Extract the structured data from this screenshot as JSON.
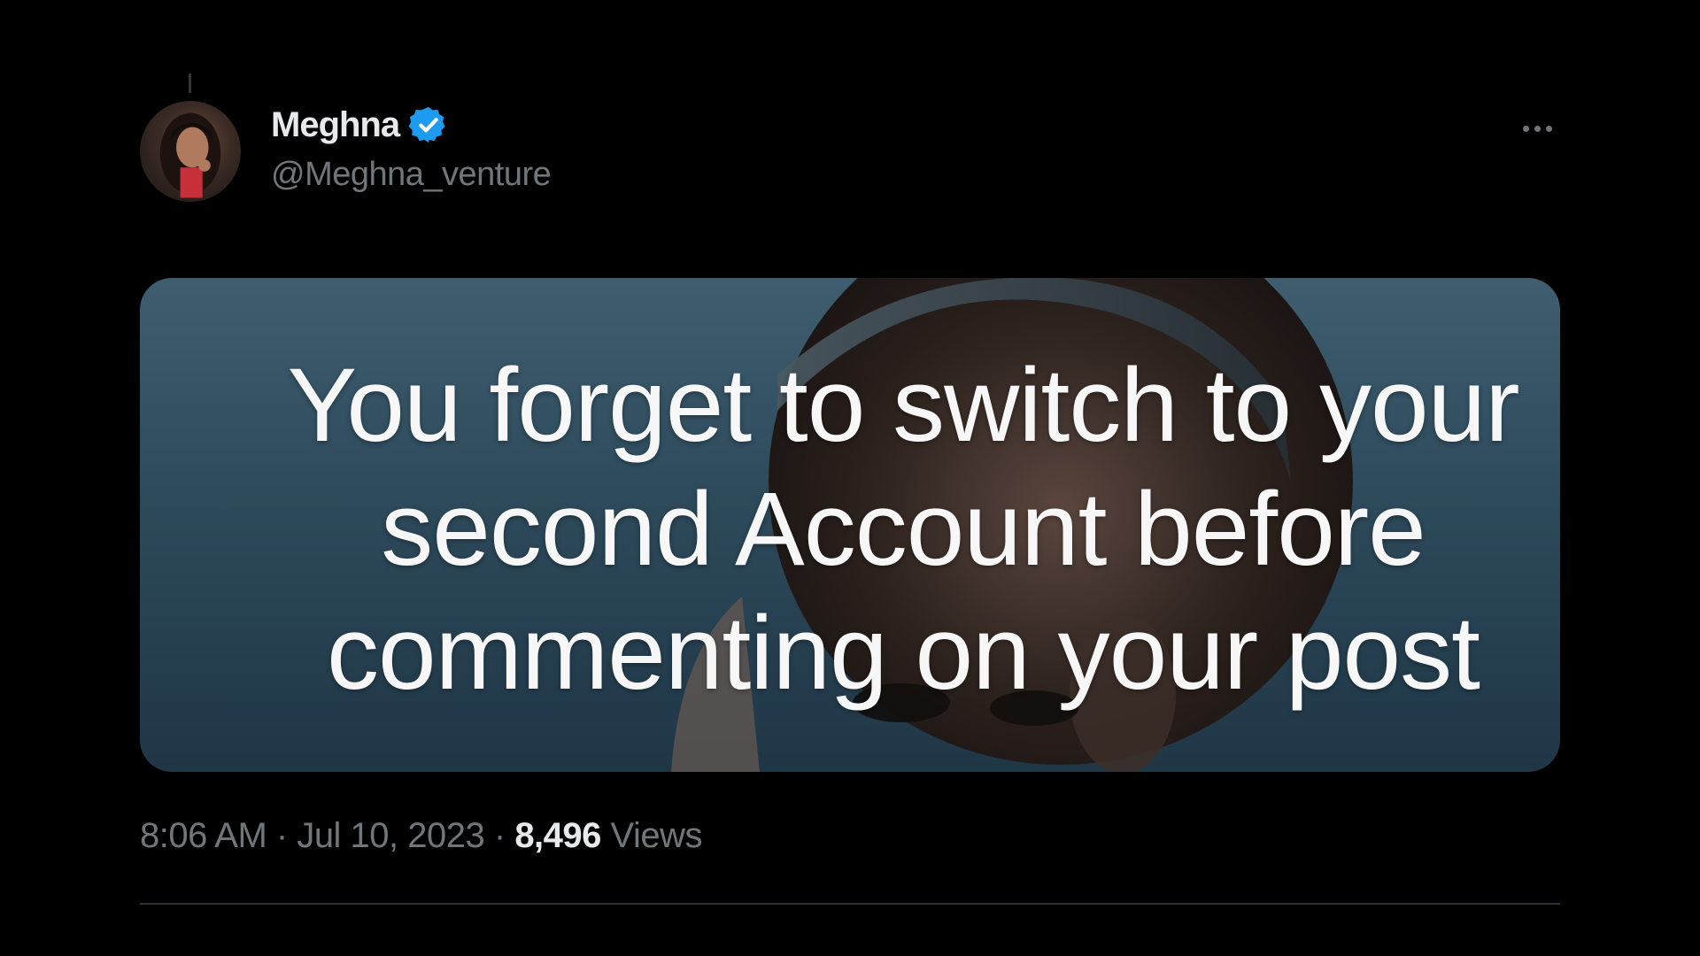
{
  "tweet": {
    "author": {
      "display_name": "Meghna",
      "handle": "@Meghna_venture",
      "verified": true,
      "verified_icon": "verified-badge-icon",
      "verified_color": "#1d9bf0"
    },
    "more_icon": "more-options-icon",
    "media": {
      "text_line_1": "You forget to switch to your",
      "text_line_2": "second Account before",
      "text_line_3": "commenting on your post"
    },
    "meta": {
      "time": "8:06 AM",
      "separator": " · ",
      "date": "Jul 10, 2023",
      "views_count": "8,496",
      "views_label": "Views"
    }
  },
  "colors": {
    "background": "#000000",
    "primary_text": "#e7e9ea",
    "secondary_text": "#71767b",
    "divider": "#2f3336"
  }
}
